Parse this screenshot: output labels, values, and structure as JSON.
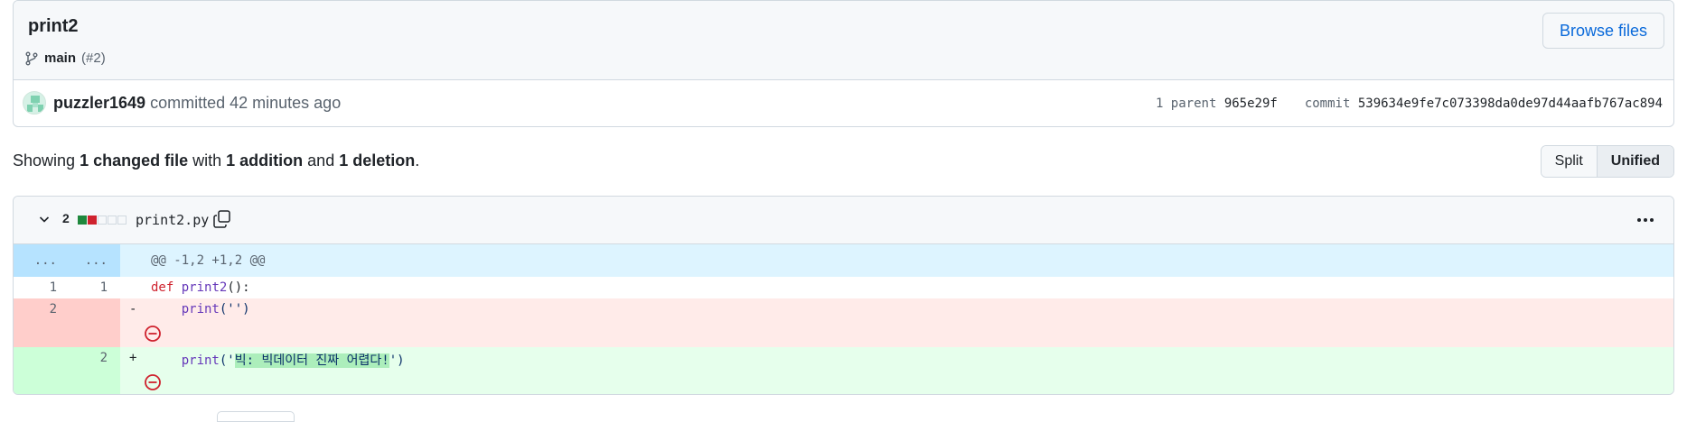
{
  "commit": {
    "title": "print2",
    "branch": "main",
    "pr_ref": "(#2)",
    "browse_files_label": "Browse files",
    "author": "puzzler1649",
    "action": "committed",
    "time_ago": "42 minutes ago",
    "parent_label": "1 parent",
    "parent_sha": "965e29f",
    "commit_label": "commit",
    "commit_sha": "539634e9fe7c073398da0de97d44aafb767ac894"
  },
  "summary": {
    "prefix": "Showing",
    "changed_files": "1 changed file",
    "with": "with",
    "additions": "1 addition",
    "and": "and",
    "deletions": "1 deletion",
    "suffix": "."
  },
  "view_toggle": {
    "split_label": "Split",
    "unified_label": "Unified",
    "selected": "Unified"
  },
  "file": {
    "change_count": "2",
    "filename": "print2.py",
    "diffstat": {
      "additions": 1,
      "deletions": 1,
      "neutral": 3
    },
    "hunk": {
      "left_num": "...",
      "right_num": "...",
      "header": "@@ -1,2 +1,2 @@"
    },
    "lines": [
      {
        "type": "context",
        "old": "1",
        "new": "1",
        "keyword": "def",
        "fn": "print2",
        "rest": "():"
      },
      {
        "type": "deletion",
        "old": "2",
        "new": "",
        "marker": "-",
        "indent": "    ",
        "fn": "print",
        "rest": "('')"
      },
      {
        "type": "addition",
        "old": "",
        "new": "2",
        "marker": "+",
        "indent": "    ",
        "fn": "print",
        "open": "('",
        "highlight": "빅: 빅데이터 진짜 어렵다!",
        "close": "')"
      }
    ]
  },
  "colors": {
    "accent_link": "#0969da",
    "addition_bg": "#e6ffec",
    "deletion_bg": "#ffebe9",
    "hunk_bg": "#ddf4ff",
    "no_newline_icon": "#cf222e"
  }
}
